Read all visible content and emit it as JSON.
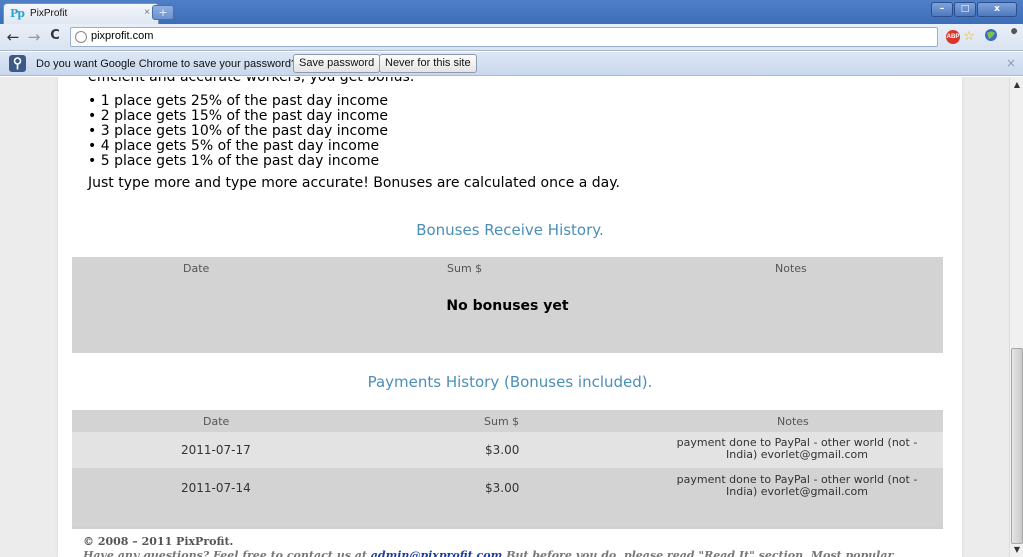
{
  "browser": {
    "tab_logo": "Pp",
    "tab_title": "PixProfit",
    "tab_close": "×",
    "new_tab": "+",
    "window_buttons": [
      "–",
      "□",
      "x"
    ],
    "url": "pixprofit.com",
    "back": "←",
    "forward": "→",
    "reload": "C",
    "abp_label": "ABP",
    "star": "☆",
    "wrench": "🔧"
  },
  "infobar": {
    "message": "Do you want Google Chrome to save your password?",
    "save_label": "Save password",
    "never_label": "Never for this site",
    "close": "×"
  },
  "content": {
    "cut_line": "efficient and accurate workers, you get bonus:",
    "bonus_rules": [
      "• 1 place gets 25% of the past day income",
      "• 2 place gets 15% of the past day income",
      "• 3 place gets 10% of the past day income",
      "• 4 place gets 5% of the past day income",
      "• 5 place gets 1% of the past day income"
    ],
    "tagline": "Just type more and type more accurate! Bonuses are calculated once a day."
  },
  "bonuses": {
    "title": "Bonuses Receive History.",
    "columns": [
      "Date",
      "Sum $",
      "Notes"
    ],
    "empty_message": "No bonuses yet"
  },
  "payments": {
    "title": "Payments History (Bonuses included).",
    "columns": [
      "Date",
      "Sum $",
      "Notes"
    ],
    "rows": [
      {
        "date": "2011-07-17",
        "sum": "$3.00",
        "note_line1": "payment done to PayPal - other world (not -",
        "note_line2": "India) evorlet@gmail.com"
      },
      {
        "date": "2011-07-14",
        "sum": "$3.00",
        "note_line1": "payment done to PayPal - other world (not -",
        "note_line2": "India) evorlet@gmail.com"
      }
    ]
  },
  "footer": {
    "copyright": "© 2008 – 2011 PixProfit.",
    "contact_prefix": "Have any questions? Feel free to contact us at ",
    "contact_email": "admin@pixprofit.com",
    "contact_suffix": " But before you do, please read \"Read It\" section. Most popular"
  },
  "scrollbar": {
    "up": "▲",
    "down": "▼"
  }
}
